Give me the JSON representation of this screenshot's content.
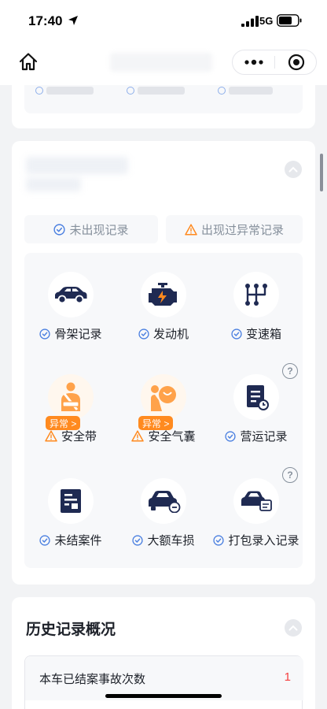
{
  "status": {
    "time": "17:40",
    "network": "5G"
  },
  "nav": {
    "home_icon": "home-icon",
    "more_icon": "more-dots-icon",
    "close_icon": "target-close-icon"
  },
  "legend": {
    "normal": "未出现记录",
    "abnormal": "出现过异常记录"
  },
  "items": [
    {
      "label": "骨架记录",
      "icon": "car-frame-icon",
      "status": "normal"
    },
    {
      "label": "发动机",
      "icon": "engine-icon",
      "status": "normal"
    },
    {
      "label": "变速箱",
      "icon": "gearbox-icon",
      "status": "normal"
    },
    {
      "label": "安全带",
      "icon": "seatbelt-icon",
      "status": "abnormal",
      "badge": "异常 >"
    },
    {
      "label": "安全气囊",
      "icon": "airbag-icon",
      "status": "abnormal",
      "badge": "异常 >"
    },
    {
      "label": "营运记录",
      "icon": "operation-record-icon",
      "status": "normal",
      "help": "?"
    },
    {
      "label": "未结案件",
      "icon": "pending-case-icon",
      "status": "normal"
    },
    {
      "label": "大额车损",
      "icon": "major-damage-icon",
      "status": "normal"
    },
    {
      "label": "打包录入记录",
      "icon": "bundle-entry-icon",
      "status": "normal",
      "help": "?"
    }
  ],
  "history": {
    "title": "历史记录概况",
    "rows": [
      {
        "label": "本车已结案事故次数",
        "value": "1"
      }
    ]
  },
  "colors": {
    "accent_blue": "#4a7fe0",
    "warning_orange": "#ff8a1f",
    "icon_navy": "#1f2a52",
    "danger_red": "#f53f3f"
  }
}
